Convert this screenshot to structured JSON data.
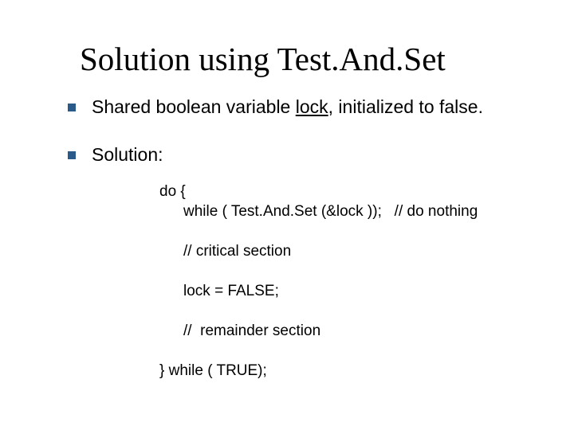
{
  "title": "Solution using Test.And.Set",
  "bullets": [
    {
      "pre": "Shared boolean variable ",
      "underlined": "lock",
      "post": ", initialized to false."
    },
    {
      "text": "Solution:"
    }
  ],
  "code": {
    "l1": "do {",
    "l2": "while ( Test.And.Set (&lock ));   // do nothing",
    "l3": "// critical section",
    "l4": "lock = FALSE;",
    "l5": "//  remainder section",
    "l6": "} while ( TRUE);"
  }
}
